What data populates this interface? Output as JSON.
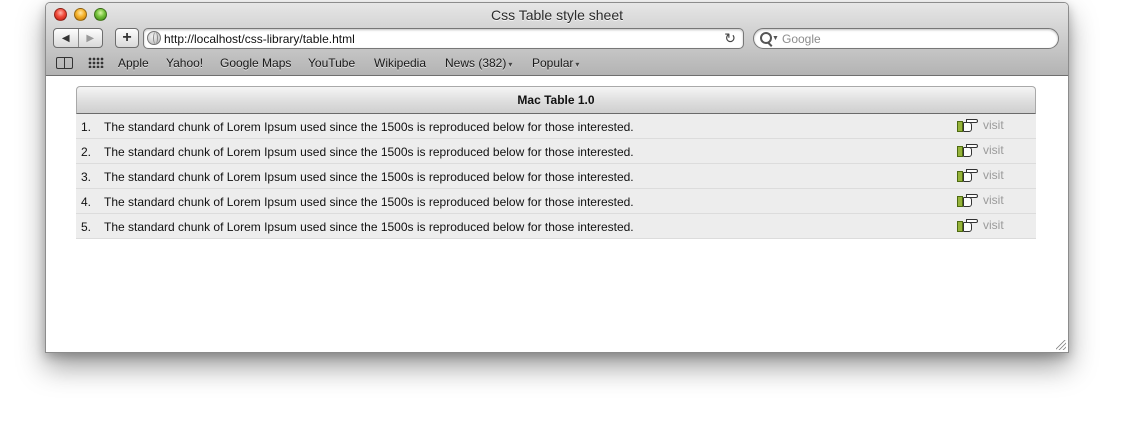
{
  "window": {
    "title": "Css Table style sheet",
    "back_label": "◀",
    "forward_label": "▶",
    "add_label": "+",
    "reload_label": "↻"
  },
  "address_bar": {
    "url": "http://localhost/css-library/table.html"
  },
  "search": {
    "placeholder": "Google",
    "caret": "▼"
  },
  "bookmarks": {
    "items": [
      {
        "label": "Apple"
      },
      {
        "label": "Yahoo!"
      },
      {
        "label": "Google Maps"
      },
      {
        "label": "YouTube"
      },
      {
        "label": "Wikipedia"
      },
      {
        "label": "News (382)",
        "arrow": "▾"
      },
      {
        "label": "Popular",
        "arrow": "▾"
      }
    ]
  },
  "table": {
    "title": "Mac Table 1.0",
    "rows": [
      {
        "num": "1.",
        "text": "The standard chunk of Lorem Ipsum used since the 1500s is reproduced below for those interested.",
        "link": "visit"
      },
      {
        "num": "2.",
        "text": "The standard chunk of Lorem Ipsum used since the 1500s is reproduced below for those interested.",
        "link": "visit"
      },
      {
        "num": "3.",
        "text": "The standard chunk of Lorem Ipsum used since the 1500s is reproduced below for those interested.",
        "link": "visit"
      },
      {
        "num": "4.",
        "text": "The standard chunk of Lorem Ipsum used since the 1500s is reproduced below for those interested.",
        "link": "visit"
      },
      {
        "num": "5.",
        "text": "The standard chunk of Lorem Ipsum used since the 1500s is reproduced below for those interested.",
        "link": "visit"
      }
    ]
  },
  "icons": {
    "window_controls": [
      "close-button-icon",
      "minimize-button-icon",
      "zoom-button-icon"
    ],
    "link_icon": "pointing-hand-icon",
    "site_icon": "globe-icon",
    "reading_list": "open-book-icon",
    "top_sites": "grid-icon"
  },
  "colors": {
    "close": "#f04a3a",
    "minimize": "#f5b22b",
    "zoom": "#74c23b",
    "row_background": "#ededed",
    "link_text": "#9a9a9a",
    "hand_cuff": "#96b33a"
  }
}
